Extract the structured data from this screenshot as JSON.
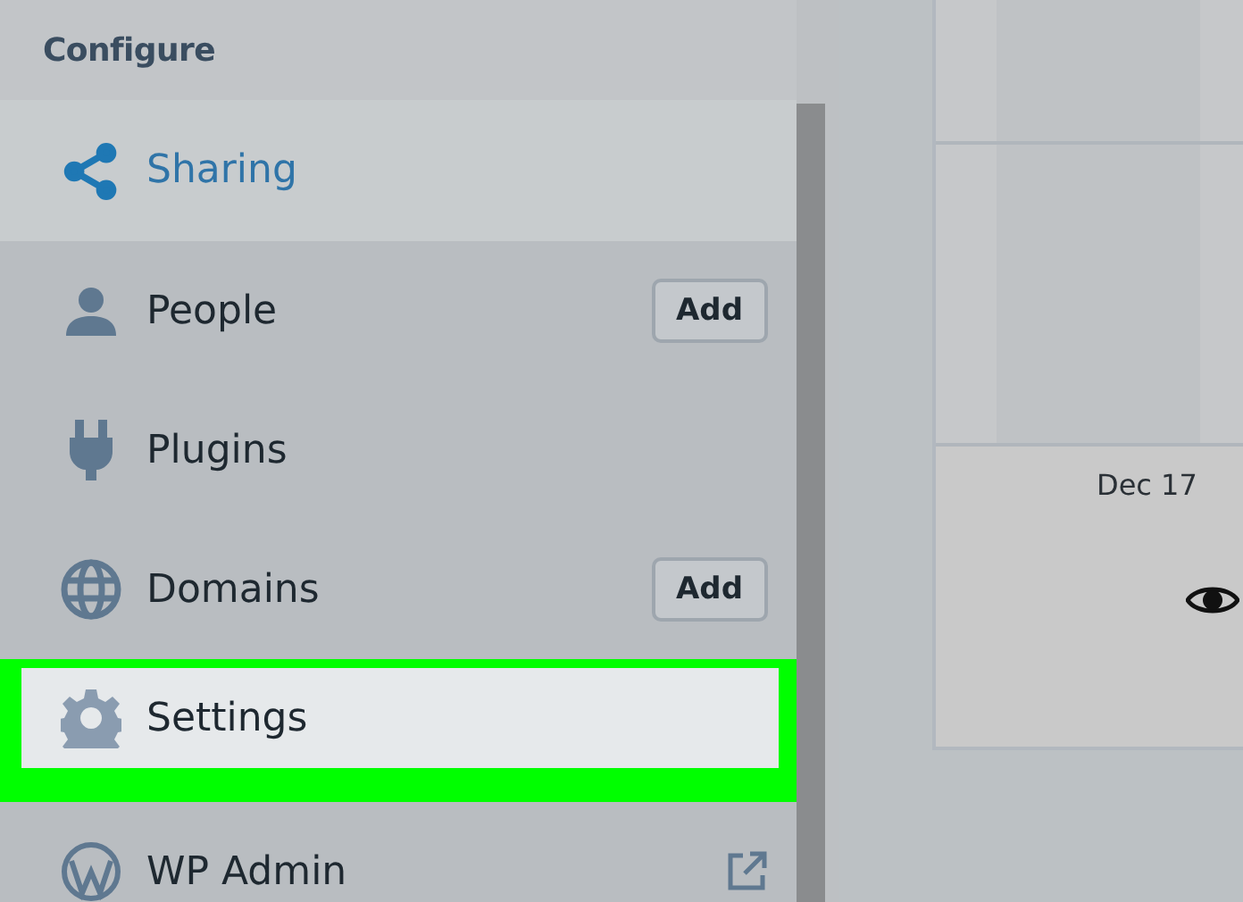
{
  "sidebar": {
    "section_title": "Configure",
    "items": [
      {
        "label": "Sharing",
        "selected": true,
        "highlighted": false
      },
      {
        "label": "People",
        "selected": false,
        "highlighted": false,
        "action": "Add"
      },
      {
        "label": "Plugins",
        "selected": false,
        "highlighted": false
      },
      {
        "label": "Domains",
        "selected": false,
        "highlighted": false,
        "action": "Add"
      },
      {
        "label": "Settings",
        "selected": false,
        "highlighted": true
      },
      {
        "label": "WP Admin",
        "selected": false,
        "highlighted": false,
        "external": true
      }
    ]
  },
  "stats": {
    "x_label": "Dec 17"
  }
}
